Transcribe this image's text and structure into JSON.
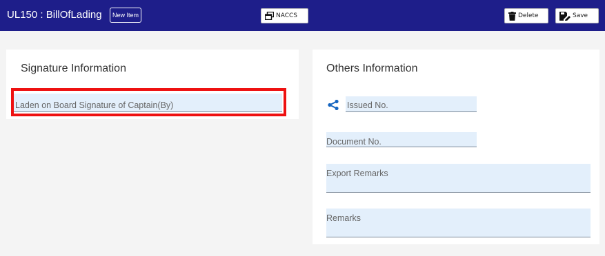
{
  "header": {
    "title": "UL150 : BillOfLading",
    "badge": "New Item",
    "naccs_label": "NACCS",
    "delete_label": "Delete",
    "save_label": "Save",
    "bg_color": "#1e1e8a"
  },
  "signature_section": {
    "title": "Signature Information",
    "laden_field_label": "Laden on Board Signature of Captain(By)"
  },
  "others_section": {
    "title": "Others Information",
    "issued_no_label": "Issued No.",
    "document_no_label": "Document No.",
    "export_remarks_label": "Export Remarks",
    "remarks_label": "Remarks"
  },
  "colors": {
    "field_bg": "#e3effb",
    "highlight": "#ee1111",
    "share_icon": "#1565c0"
  },
  "icons": {
    "naccs": "window-icon",
    "delete": "trash-icon",
    "save": "save-edit-icon",
    "issued": "share-icon"
  }
}
